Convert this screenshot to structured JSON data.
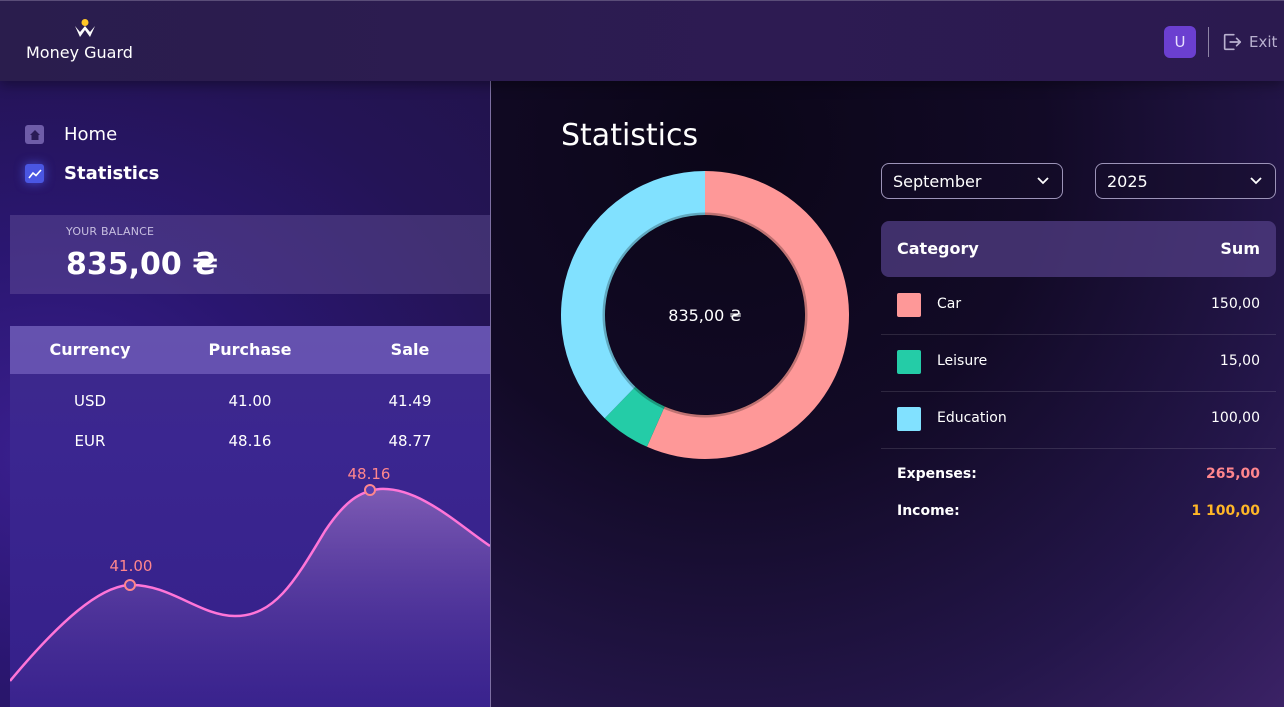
{
  "app": {
    "name": "Money Guard"
  },
  "header": {
    "avatar_letter": "U",
    "exit_label": "Exit"
  },
  "nav": {
    "home": "Home",
    "statistics": "Statistics"
  },
  "balance": {
    "label": "YOUR BALANCE",
    "value": "835,00 ₴"
  },
  "currency": {
    "headers": [
      "Currency",
      "Purchase",
      "Sale"
    ],
    "rows": [
      {
        "currency": "USD",
        "purchase": "41.00",
        "sale": "41.49"
      },
      {
        "currency": "EUR",
        "purchase": "48.16",
        "sale": "48.77"
      }
    ],
    "graph_labels": {
      "usd": "41.00",
      "eur": "48.16"
    }
  },
  "statistics": {
    "title": "Statistics",
    "total": "835,00 ₴",
    "month": "September",
    "year": "2025",
    "table_headers": {
      "category": "Category",
      "sum": "Sum"
    },
    "categories": [
      {
        "name": "Car",
        "sum": "150,00",
        "color": "#fe9898"
      },
      {
        "name": "Leisure",
        "sum": "15,00",
        "color": "#24cca7"
      },
      {
        "name": "Education",
        "sum": "100,00",
        "color": "#81e1ff"
      }
    ],
    "expenses_label": "Expenses:",
    "expenses_value": "265,00",
    "expenses_color": "#ff868d",
    "income_label": "Income:",
    "income_value": "1 100,00",
    "income_color": "#ffb627"
  },
  "chart_data": {
    "type": "pie",
    "categories": [
      "Car",
      "Leisure",
      "Education"
    ],
    "values": [
      150,
      15,
      100
    ],
    "colors": [
      "#fe9898",
      "#24cca7",
      "#81e1ff"
    ]
  }
}
